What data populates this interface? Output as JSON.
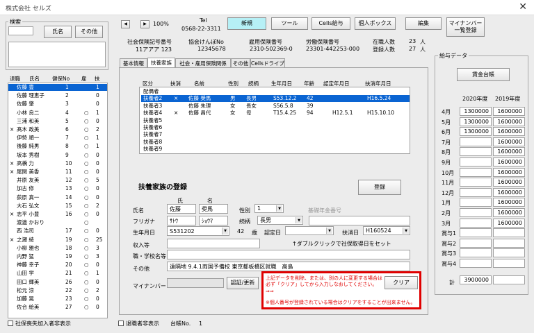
{
  "window": {
    "title": "株式会社 セルズ",
    "close": "✕"
  },
  "search": {
    "title": "検索",
    "name_btn": "氏名",
    "other_btn": "その他"
  },
  "employee_list": {
    "headers": [
      "退職",
      "氏名",
      "健保No",
      "雇",
      "扶"
    ],
    "rows": [
      {
        "ret": "",
        "name": "佐藤 豊",
        "no": "1",
        "emp": "",
        "dep": "1"
      },
      {
        "ret": "",
        "name": "佐藤 理恵子",
        "no": "2",
        "emp": "",
        "dep": "0"
      },
      {
        "ret": "",
        "name": "佐藤 肇",
        "no": "3",
        "emp": "",
        "dep": "0"
      },
      {
        "ret": "",
        "name": "小林 良二",
        "no": "4",
        "emp": "○",
        "dep": "1"
      },
      {
        "ret": "",
        "name": "三浦 和美",
        "no": "5",
        "emp": "○",
        "dep": "0"
      },
      {
        "ret": "×",
        "name": "髙木 政美",
        "no": "6",
        "emp": "○",
        "dep": "2"
      },
      {
        "ret": "",
        "name": "伊勢 順一",
        "no": "7",
        "emp": "○",
        "dep": "1"
      },
      {
        "ret": "",
        "name": "後藤 純男",
        "no": "8",
        "emp": "○",
        "dep": "1"
      },
      {
        "ret": "",
        "name": "坂本 秀樹",
        "no": "9",
        "emp": "○",
        "dep": "0"
      },
      {
        "ret": "×",
        "name": "高橋 力",
        "no": "10",
        "emp": "○",
        "dep": "0"
      },
      {
        "ret": "×",
        "name": "尾関 美香",
        "no": "11",
        "emp": "○",
        "dep": "0"
      },
      {
        "ret": "",
        "name": "井原 友美",
        "no": "12",
        "emp": "○",
        "dep": "5"
      },
      {
        "ret": "",
        "name": "加古 修",
        "no": "13",
        "emp": "○",
        "dep": "0"
      },
      {
        "ret": "",
        "name": "荻原 真一",
        "no": "14",
        "emp": "○",
        "dep": "0"
      },
      {
        "ret": "",
        "name": "大石 弘文",
        "no": "15",
        "emp": "○",
        "dep": "2"
      },
      {
        "ret": "×",
        "name": "志平 小豊",
        "no": "16",
        "emp": "○",
        "dep": "0"
      },
      {
        "ret": "",
        "name": "渡邊 かおり",
        "no": "",
        "emp": "○",
        "dep": ""
      },
      {
        "ret": "",
        "name": "西 浩司",
        "no": "17",
        "emp": "○",
        "dep": "0"
      },
      {
        "ret": "×",
        "name": "之瀬 綾",
        "no": "19",
        "emp": "○",
        "dep": "25"
      },
      {
        "ret": "",
        "name": "小柳 雅也",
        "no": "18",
        "emp": "○",
        "dep": "3"
      },
      {
        "ret": "",
        "name": "内野 猛",
        "no": "19",
        "emp": "○",
        "dep": "3"
      },
      {
        "ret": "",
        "name": "神藤 幸子",
        "no": "20",
        "emp": "○",
        "dep": "0"
      },
      {
        "ret": "",
        "name": "山田 学",
        "no": "21",
        "emp": "○",
        "dep": "1"
      },
      {
        "ret": "",
        "name": "田口 輝美",
        "no": "26",
        "emp": "○",
        "dep": "0"
      },
      {
        "ret": "",
        "name": "松元 涼",
        "no": "22",
        "emp": "○",
        "dep": "2"
      },
      {
        "ret": "",
        "name": "加藤 晃",
        "no": "23",
        "emp": "○",
        "dep": "0"
      },
      {
        "ret": "",
        "name": "佐合 絵美",
        "no": "27",
        "emp": "○",
        "dep": "0"
      }
    ]
  },
  "bottom_left": {
    "hide_label": "社保喪失加入者非表示"
  },
  "toolbar": {
    "zoom": "100%",
    "tel_label": "Tel",
    "tel": "0568-22-3311",
    "new": "新規",
    "tools": "ツール",
    "cells_pay": "Cells給与",
    "personal_box": "個人ボックス",
    "edit": "編集",
    "mynumber_list": "マイナンバー\n一覧登録"
  },
  "info": {
    "shaho_label": "社会保険記号番号",
    "shaho_value": "11アアア 123",
    "kenpo_label": "協会けんぽNo",
    "kenpo_value": "12345678",
    "koyo_label": "雇用保険番号",
    "koyo_value": "2310-502369-0",
    "rodo_label": "労働保険番号",
    "rodo_value": "23301-442253-000",
    "current_label": "在職人数",
    "current_value": "23",
    "registered_label": "登録人数",
    "registered_value": "27",
    "unit": "人"
  },
  "tabs": [
    "基本情報",
    "扶養家族",
    "社会・雇用保険関係",
    "その他",
    "Cellsドライブ"
  ],
  "family_list": {
    "headers": [
      "区分",
      "扶消",
      "名前",
      "性別",
      "続柄",
      "生年月日",
      "年齢",
      "認定年月日",
      "扶消年月日"
    ],
    "rows": [
      {
        "kubun": "配偶者",
        "fus": "",
        "name": "",
        "sex": "",
        "rel": "",
        "dob": "",
        "age": "",
        "nintei": "",
        "end": ""
      },
      {
        "kubun": "扶養者2",
        "fus": "×",
        "name": "佐藤 奨馬",
        "sex": "男",
        "rel": "長男",
        "dob": "S53.12.2",
        "age": "42",
        "nintei": "",
        "end": "H16.5.24"
      },
      {
        "kubun": "扶養者3",
        "fus": "",
        "name": "佐藤 朱理",
        "sex": "女",
        "rel": "長女",
        "dob": "S56.5.8",
        "age": "39",
        "nintei": "",
        "end": ""
      },
      {
        "kubun": "扶養者4",
        "fus": "×",
        "name": "佐藤 昌代",
        "sex": "女",
        "rel": "母",
        "dob": "T15.4.25",
        "age": "94",
        "nintei": "H12.5.1",
        "end": "H15.10.10"
      },
      {
        "kubun": "扶養者5",
        "fus": "",
        "name": "",
        "sex": "",
        "rel": "",
        "dob": "",
        "age": "",
        "nintei": "",
        "end": ""
      },
      {
        "kubun": "扶養者6",
        "fus": "",
        "name": "",
        "sex": "",
        "rel": "",
        "dob": "",
        "age": "",
        "nintei": "",
        "end": ""
      },
      {
        "kubun": "扶養者7",
        "fus": "",
        "name": "",
        "sex": "",
        "rel": "",
        "dob": "",
        "age": "",
        "nintei": "",
        "end": ""
      },
      {
        "kubun": "扶養者8",
        "fus": "",
        "name": "",
        "sex": "",
        "rel": "",
        "dob": "",
        "age": "",
        "nintei": "",
        "end": ""
      },
      {
        "kubun": "扶養者9",
        "fus": "",
        "name": "",
        "sex": "",
        "rel": "",
        "dob": "",
        "age": "",
        "nintei": "",
        "end": ""
      }
    ]
  },
  "form": {
    "title": "扶養家族の登録",
    "register_btn": "登録",
    "sei_label": "氏",
    "mei_label": "名",
    "name_label": "氏名",
    "sei": "佐藤",
    "mei": "奨馬",
    "furigana_label": "フリガナ",
    "sei_kana": "ｻﾄｳ",
    "mei_kana": "ｼｮｳﾏ",
    "sex_label": "性別",
    "sex_value": "1",
    "pension_label": "基礎年金番号",
    "rel_label": "続柄",
    "rel_value": "長男",
    "dob_label": "生年月日",
    "dob_value": "S531202",
    "age_value": "42",
    "age_unit": "歳",
    "nintei_label": "認定日",
    "end_label": "扶消日",
    "end_value": "H160524",
    "dblclick_hint": "↑ダブルクリックで社保取得日をセット",
    "income_label": "収入等",
    "job_label": "職・学校名等",
    "other_label": "その他",
    "other_value": "遠隔地 9.4.1両国予備校 東京都板橋区就職　高島",
    "mynumber_label": "マイナンバー",
    "auth_btn": "認証/更新",
    "warning1": "上記データを削除、または、別の人に変更する場合は必ず「クリア」してから入力しなおしてください。⇒⇒",
    "clear_btn": "クリア",
    "warning2": "※個人番号が登録されている場合はクリアをすることが出来ません。"
  },
  "bottom_mid": {
    "hide_retired": "退職者非表示",
    "ledger_label": "台帳No.",
    "ledger_value": "1"
  },
  "salary": {
    "title": "給与データ",
    "ledger_btn": "賃金台帳",
    "year1": "2020年度",
    "year2": "2019年度",
    "months": [
      "4月",
      "5月",
      "6月",
      "7月",
      "8月",
      "9月",
      "10月",
      "11月",
      "12月",
      "1月",
      "2月",
      "3月",
      "賞与1",
      "賞与2",
      "賞与3",
      "賞与4"
    ],
    "values2020": [
      "1300000",
      "1300000",
      "1300000",
      "",
      "",
      "",
      "",
      "",
      "",
      "",
      "",
      "",
      "",
      "",
      "",
      ""
    ],
    "values2019": [
      "1600000",
      "1600000",
      "1600000",
      "1600000",
      "1600000",
      "1600000",
      "1600000",
      "1600000",
      "1600000",
      "1600000",
      "1600000",
      "1600000",
      "",
      "",
      "",
      ""
    ],
    "total_label": "計",
    "total_value": "3900000"
  },
  "colors": {
    "selection": "#0a64d2",
    "accent_button": "#b6f0f6",
    "warning": "#e00000"
  }
}
